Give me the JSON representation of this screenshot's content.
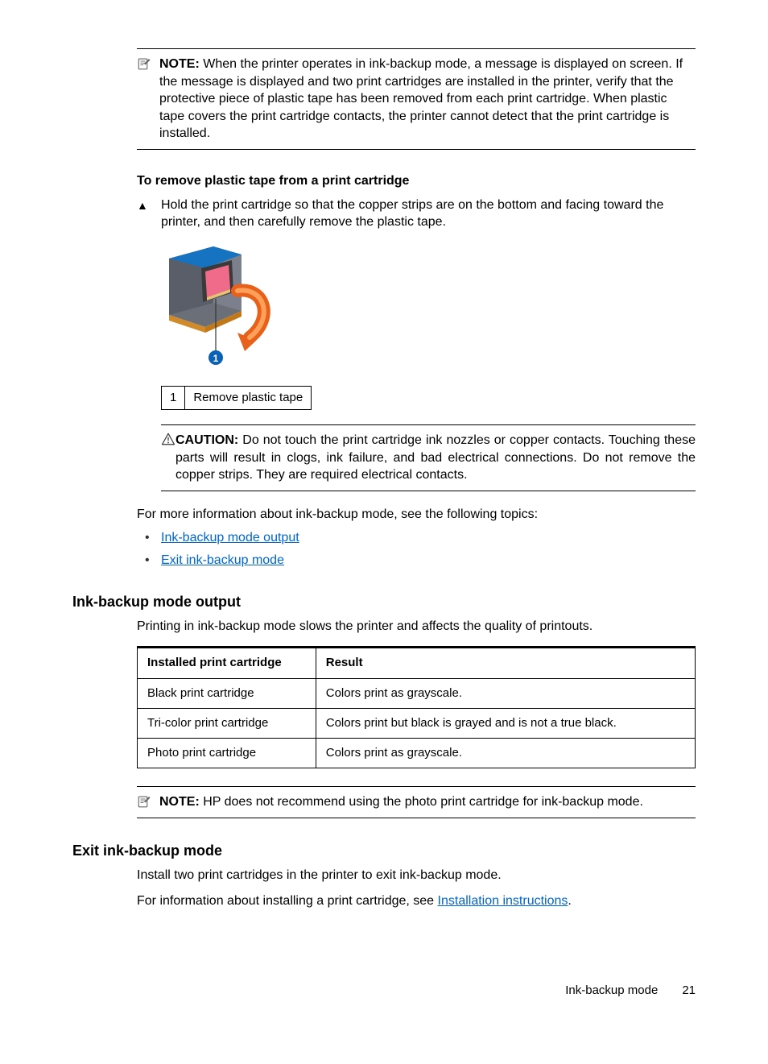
{
  "note1": {
    "label": "NOTE:",
    "text": "When the printer operates in ink-backup mode, a message is displayed on screen. If the message is displayed and two print cartridges are installed in the printer, verify that the protective piece of plastic tape has been removed from each print cartridge. When plastic tape covers the print cartridge contacts, the printer cannot detect that the print cartridge is installed."
  },
  "remove_tape": {
    "heading": "To remove plastic tape from a print cartridge",
    "step_marker": "▲",
    "step_text": "Hold the print cartridge so that the copper strips are on the bottom and facing toward the printer, and then carefully remove the plastic tape.",
    "callout_num": "1",
    "callout_text": "Remove plastic tape"
  },
  "caution": {
    "label": "CAUTION:",
    "text": "Do not touch the print cartridge ink nozzles or copper contacts. Touching these parts will result in clogs, ink failure, and bad electrical connections. Do not remove the copper strips. They are required electrical contacts."
  },
  "more_info": {
    "intro": "For more information about ink-backup mode, see the following topics:",
    "links": [
      "Ink-backup mode output",
      "Exit ink-backup mode"
    ]
  },
  "section1": {
    "heading": "Ink-backup mode output",
    "intro": "Printing in ink-backup mode slows the printer and affects the quality of printouts."
  },
  "chart_data": {
    "type": "table",
    "headers": [
      "Installed print cartridge",
      "Result"
    ],
    "rows": [
      [
        "Black print cartridge",
        "Colors print as grayscale."
      ],
      [
        "Tri-color print cartridge",
        "Colors print but black is grayed and is not a true black."
      ],
      [
        "Photo print cartridge",
        "Colors print as grayscale."
      ]
    ]
  },
  "note2": {
    "label": "NOTE:",
    "text": "HP does not recommend using the photo print cartridge for ink-backup mode."
  },
  "section2": {
    "heading": "Exit ink-backup mode",
    "p1": "Install two print cartridges in the printer to exit ink-backup mode.",
    "p2a": "For information about installing a print cartridge, see ",
    "p2_link": "Installation instructions",
    "p2b": "."
  },
  "footer": {
    "title": "Ink-backup mode",
    "page": "21"
  }
}
